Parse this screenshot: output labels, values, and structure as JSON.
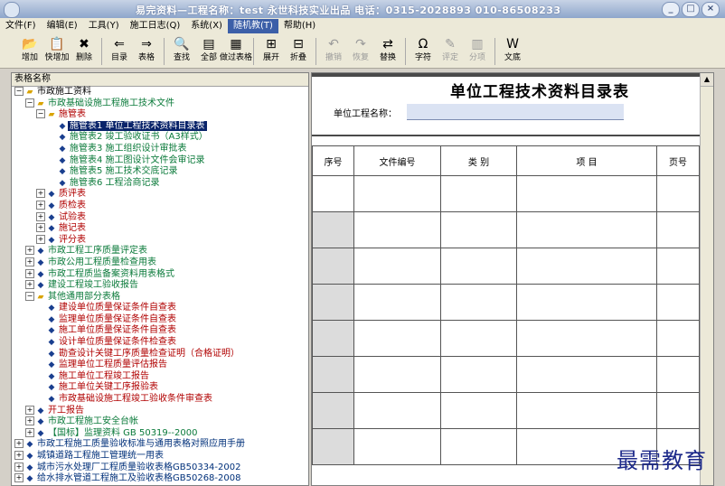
{
  "titlebar": {
    "title": "易完资料—工程名称：test    永世科技实业出品 电话：0315-2028893 010-86508233",
    "controls": [
      "_",
      "□",
      "×"
    ]
  },
  "menu": [
    {
      "label": "文件(F)",
      "active": false
    },
    {
      "label": "编辑(E)",
      "active": false
    },
    {
      "label": "工具(Y)",
      "active": false
    },
    {
      "label": "施工日志(Q)",
      "active": false
    },
    {
      "label": "系统(X)",
      "active": false
    },
    {
      "label": "随机教(T)",
      "active": true
    },
    {
      "label": "帮助(H)",
      "active": false
    }
  ],
  "toolbar": [
    {
      "label": "增加",
      "icon": "📂",
      "disabled": false
    },
    {
      "label": "快增加",
      "icon": "📋",
      "disabled": false
    },
    {
      "label": "删除",
      "icon": "✖",
      "disabled": false
    },
    {
      "sep": true
    },
    {
      "label": "目录",
      "icon": "⇐",
      "disabled": false
    },
    {
      "label": "表格",
      "icon": "⇒",
      "disabled": false
    },
    {
      "sep": true
    },
    {
      "label": "查找",
      "icon": "🔍",
      "disabled": false
    },
    {
      "label": "全部",
      "icon": "▤",
      "disabled": false
    },
    {
      "label": "做过表格",
      "icon": "▦",
      "disabled": false
    },
    {
      "sep": true
    },
    {
      "label": "展开",
      "icon": "⊞",
      "disabled": false
    },
    {
      "label": "折叠",
      "icon": "⊟",
      "disabled": false
    },
    {
      "sep": true
    },
    {
      "label": "撤销",
      "icon": "↶",
      "disabled": true
    },
    {
      "label": "恢复",
      "icon": "↷",
      "disabled": true
    },
    {
      "label": "替换",
      "icon": "⇄",
      "disabled": false
    },
    {
      "sep": true
    },
    {
      "label": "字符",
      "icon": "Ω",
      "disabled": false
    },
    {
      "label": "评定",
      "icon": "✎",
      "disabled": true
    },
    {
      "label": "分项",
      "icon": "▥",
      "disabled": true
    },
    {
      "sep": true
    },
    {
      "label": "文底",
      "icon": "W",
      "disabled": false
    }
  ],
  "tree": {
    "header": "表格名称",
    "rows": [
      {
        "indent": 0,
        "exp": "−",
        "icon": "folder",
        "label": "市政施工资料",
        "color": "blk"
      },
      {
        "indent": 1,
        "exp": "−",
        "icon": "folder",
        "label": "市政基础设施工程施工技术文件",
        "color": "grn"
      },
      {
        "indent": 2,
        "exp": "−",
        "icon": "folder",
        "label": "施管表",
        "color": "red"
      },
      {
        "indent": 3,
        "exp": "",
        "icon": "doc",
        "label": "施管表1   单位工程技术资料目录表",
        "color": "red",
        "selected": true
      },
      {
        "indent": 3,
        "exp": "",
        "icon": "doc",
        "label": "施管表2   竣工验收证书（A3样式）",
        "color": "grn"
      },
      {
        "indent": 3,
        "exp": "",
        "icon": "doc",
        "label": "施管表3   施工组织设计审批表",
        "color": "grn"
      },
      {
        "indent": 3,
        "exp": "",
        "icon": "doc",
        "label": "施管表4   施工图设计文件会审记录",
        "color": "grn"
      },
      {
        "indent": 3,
        "exp": "",
        "icon": "doc",
        "label": "施管表5   施工技术交底记录",
        "color": "grn"
      },
      {
        "indent": 3,
        "exp": "",
        "icon": "doc",
        "label": "施管表6   工程洽商记录",
        "color": "grn"
      },
      {
        "indent": 2,
        "exp": "+",
        "icon": "doc",
        "label": "质评表",
        "color": "red"
      },
      {
        "indent": 2,
        "exp": "+",
        "icon": "doc",
        "label": "质检表",
        "color": "red"
      },
      {
        "indent": 2,
        "exp": "+",
        "icon": "doc",
        "label": "试验表",
        "color": "red"
      },
      {
        "indent": 2,
        "exp": "+",
        "icon": "doc",
        "label": "施记表",
        "color": "red"
      },
      {
        "indent": 2,
        "exp": "+",
        "icon": "doc",
        "label": "评分表",
        "color": "red"
      },
      {
        "indent": 1,
        "exp": "+",
        "icon": "doc",
        "label": "市政工程工序质量评定表",
        "color": "grn"
      },
      {
        "indent": 1,
        "exp": "+",
        "icon": "doc",
        "label": "市政公用工程质量检查用表",
        "color": "grn"
      },
      {
        "indent": 1,
        "exp": "+",
        "icon": "doc",
        "label": "市政工程质监备案资料用表格式",
        "color": "grn"
      },
      {
        "indent": 1,
        "exp": "+",
        "icon": "doc",
        "label": "建设工程竣工验收报告",
        "color": "grn"
      },
      {
        "indent": 1,
        "exp": "−",
        "icon": "folder",
        "label": "其他通用部分表格",
        "color": "grn"
      },
      {
        "indent": 2,
        "exp": "",
        "icon": "doc",
        "label": "建设单位质量保证条件自查表",
        "color": "red"
      },
      {
        "indent": 2,
        "exp": "",
        "icon": "doc",
        "label": "监理单位质量保证条件自查表",
        "color": "red"
      },
      {
        "indent": 2,
        "exp": "",
        "icon": "doc",
        "label": "施工单位质量保证条件自查表",
        "color": "red"
      },
      {
        "indent": 2,
        "exp": "",
        "icon": "doc",
        "label": "设计单位质量保证条件检查表",
        "color": "red"
      },
      {
        "indent": 2,
        "exp": "",
        "icon": "doc",
        "label": "勘查设计关键工序质量检查证明（合格证明）",
        "color": "red"
      },
      {
        "indent": 2,
        "exp": "",
        "icon": "doc",
        "label": "监理单位工程质量评估报告",
        "color": "red"
      },
      {
        "indent": 2,
        "exp": "",
        "icon": "doc",
        "label": "施工单位工程竣工报告",
        "color": "red"
      },
      {
        "indent": 2,
        "exp": "",
        "icon": "doc",
        "label": "施工单位关键工序报验表",
        "color": "red"
      },
      {
        "indent": 2,
        "exp": "",
        "icon": "doc",
        "label": "市政基础设施工程竣工验收条件审查表",
        "color": "red"
      },
      {
        "indent": 1,
        "exp": "+",
        "icon": "doc",
        "label": "开工报告",
        "color": "red"
      },
      {
        "indent": 1,
        "exp": "+",
        "icon": "doc",
        "label": "市政工程施工安全台帐",
        "color": "grn"
      },
      {
        "indent": 1,
        "exp": "+",
        "icon": "doc",
        "label": "【国标】监理资料 GB 50319--2000",
        "color": "grn"
      },
      {
        "indent": 0,
        "exp": "+",
        "icon": "doc",
        "label": "市政工程施工质量验收标准与通用表格对照应用手册",
        "color": "navy"
      },
      {
        "indent": 0,
        "exp": "+",
        "icon": "doc",
        "label": "城镇道路工程施工管理统一用表",
        "color": "navy"
      },
      {
        "indent": 0,
        "exp": "+",
        "icon": "doc",
        "label": "城市污水处理厂工程质量验收表格GB50334-2002",
        "color": "navy"
      },
      {
        "indent": 0,
        "exp": "+",
        "icon": "doc",
        "label": "给水排水管道工程施工及验收表格GB50268-2008",
        "color": "navy"
      }
    ]
  },
  "form": {
    "title": "单位工程技术资料目录表",
    "project_label": "单位工程名称：",
    "project_value": "",
    "columns": [
      "序号",
      "文件编号",
      "类   别",
      "项       目",
      "页号"
    ],
    "row_count": 8
  },
  "watermark": "最需教育"
}
